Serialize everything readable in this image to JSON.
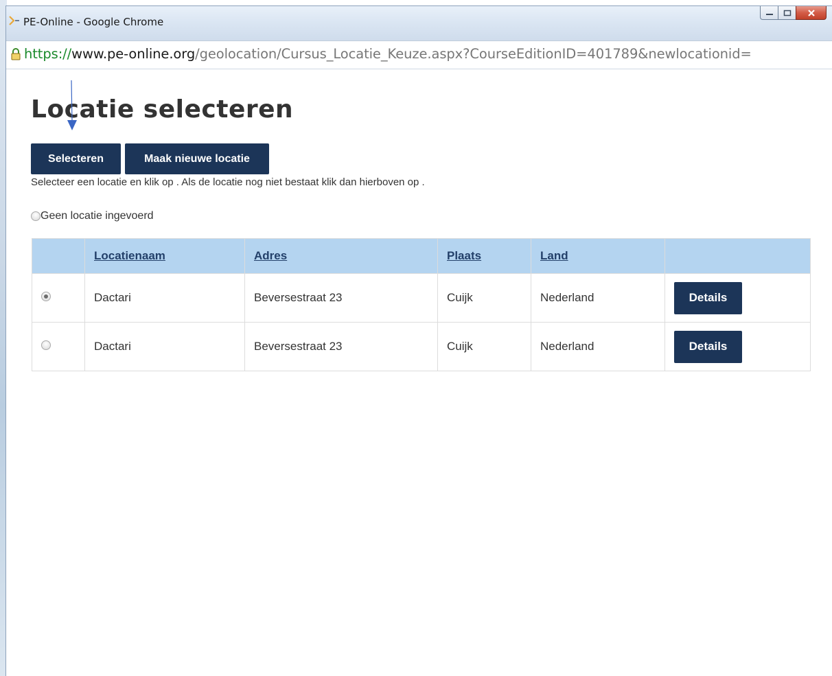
{
  "window": {
    "title": "PE-Online - Google Chrome",
    "url_scheme": "https://",
    "url_host": "www.pe-online.org",
    "url_path": "/geolocation/Cursus_Locatie_Keuze.aspx?CourseEditionID=401789&newlocationid="
  },
  "page": {
    "title": "Locatie selecteren",
    "select_button": "Selecteren",
    "new_location_button": "Maak nieuwe locatie",
    "help_text": "Selecteer een locatie en klik op . Als de locatie nog niet bestaat klik dan hierboven op .",
    "no_location_label": "Geen locatie ingevoerd"
  },
  "table": {
    "headers": {
      "name": "Locatienaam",
      "adres": "Adres",
      "plaats": "Plaats",
      "land": "Land"
    },
    "rows": [
      {
        "selected": true,
        "name": "Dactari",
        "adres": "Beversestraat 23",
        "plaats": "Cuijk",
        "land": "Nederland",
        "details": "Details"
      },
      {
        "selected": false,
        "name": "Dactari",
        "adres": "Beversestraat 23",
        "plaats": "Cuijk",
        "land": "Nederland",
        "details": "Details"
      }
    ]
  },
  "colors": {
    "button_bg": "#1c3558",
    "header_bg": "#b4d4f0",
    "annotation_arrow": "#3a66c4"
  }
}
